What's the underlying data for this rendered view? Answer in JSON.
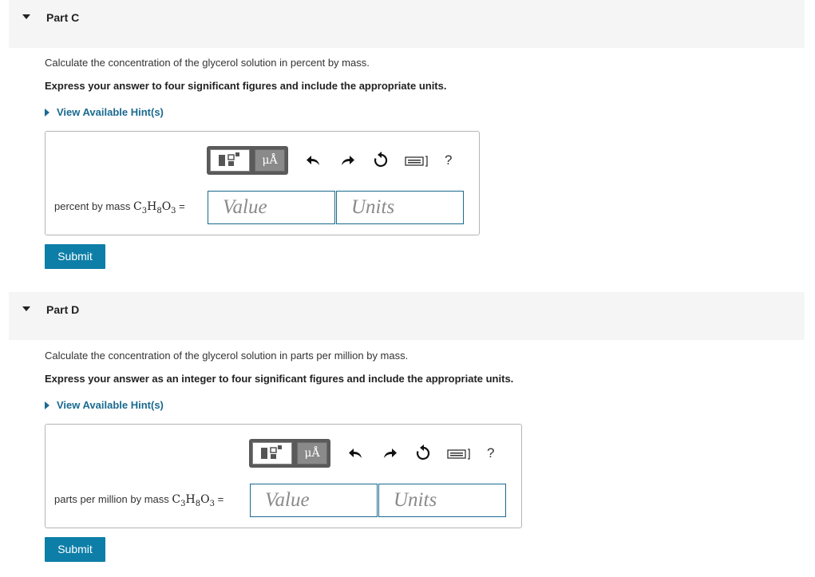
{
  "parts": [
    {
      "title": "Part C",
      "question": "Calculate the concentration of the glycerol solution in percent by mass.",
      "instruction": "Express your answer to four significant figures and include the appropriate units.",
      "hint_link": "View Available Hint(s)",
      "answer_label": "percent by mass",
      "value_placeholder": "Value",
      "units_placeholder": "Units",
      "submit_label": "Submit"
    },
    {
      "title": "Part D",
      "question": "Calculate the concentration of the glycerol solution in parts per million by mass.",
      "instruction": "Express your answer as an integer to four significant figures and include the appropriate units.",
      "hint_link": "View Available Hint(s)",
      "answer_label": "parts per million by mass",
      "value_placeholder": "Value",
      "units_placeholder": "Units",
      "submit_label": "Submit"
    }
  ],
  "formula": {
    "c": "C",
    "c_sub": "3",
    "h": "H",
    "h_sub": "8",
    "o": "O",
    "o_sub": "3",
    "equals": "="
  },
  "toolbar": {
    "units_button": "μÅ",
    "help": "?",
    "icons": [
      "templates-icon",
      "units-icon",
      "undo-icon",
      "redo-icon",
      "reset-icon",
      "keyboard-icon",
      "help-icon"
    ]
  }
}
